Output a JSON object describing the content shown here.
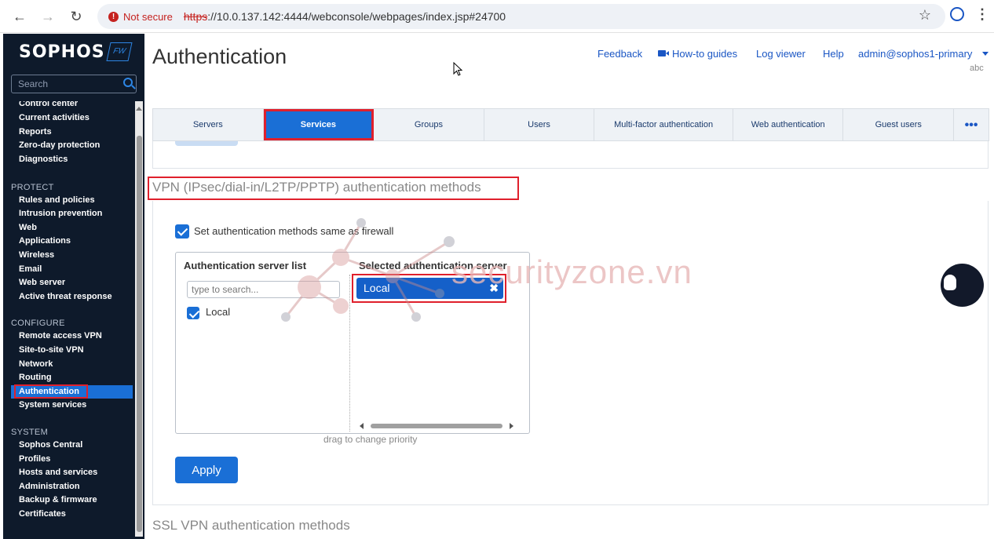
{
  "browser": {
    "security_label": "Not secure",
    "url_scheme": "https",
    "url_rest": "://10.0.137.142:4444/webconsole/webpages/index.jsp#24700"
  },
  "sidebar": {
    "logo": "SOPHOS",
    "badge": "FW",
    "search_placeholder": "Search",
    "items_top": [
      "Control center",
      "Current activities",
      "Reports",
      "Zero-day protection",
      "Diagnostics"
    ],
    "protect_heading": "PROTECT",
    "protect_items": [
      "Rules and policies",
      "Intrusion prevention",
      "Web",
      "Applications",
      "Wireless",
      "Email",
      "Web server",
      "Active threat response"
    ],
    "configure_heading": "CONFIGURE",
    "configure_items": [
      "Remote access VPN",
      "Site-to-site VPN",
      "Network",
      "Routing",
      "Authentication",
      "System services"
    ],
    "system_heading": "SYSTEM",
    "system_items": [
      "Sophos Central",
      "Profiles",
      "Hosts and services",
      "Administration",
      "Backup & firmware",
      "Certificates"
    ]
  },
  "header": {
    "title": "Authentication",
    "feedback": "Feedback",
    "howto": "How-to guides",
    "log_viewer": "Log viewer",
    "help": "Help",
    "admin": "admin@sophos1-primary",
    "sub": "abc"
  },
  "tabs": [
    "Servers",
    "Services",
    "Groups",
    "Users",
    "Multi-factor authentication",
    "Web authentication",
    "Guest users",
    "•••"
  ],
  "vpn_section": {
    "title": "VPN (IPsec/dial-in/L2TP/PPTP) authentication methods",
    "same_as_firewall": "Set authentication methods same as firewall",
    "server_list_head": "Authentication server list",
    "selected_head": "Selected authentication server",
    "filter_placeholder": "type to search...",
    "available": [
      "Local"
    ],
    "selected": [
      "Local"
    ],
    "drag_hint": "drag to change priority",
    "apply": "Apply"
  },
  "ssl_section": {
    "title": "SSL VPN authentication methods"
  },
  "watermark": "securityzone.vn"
}
